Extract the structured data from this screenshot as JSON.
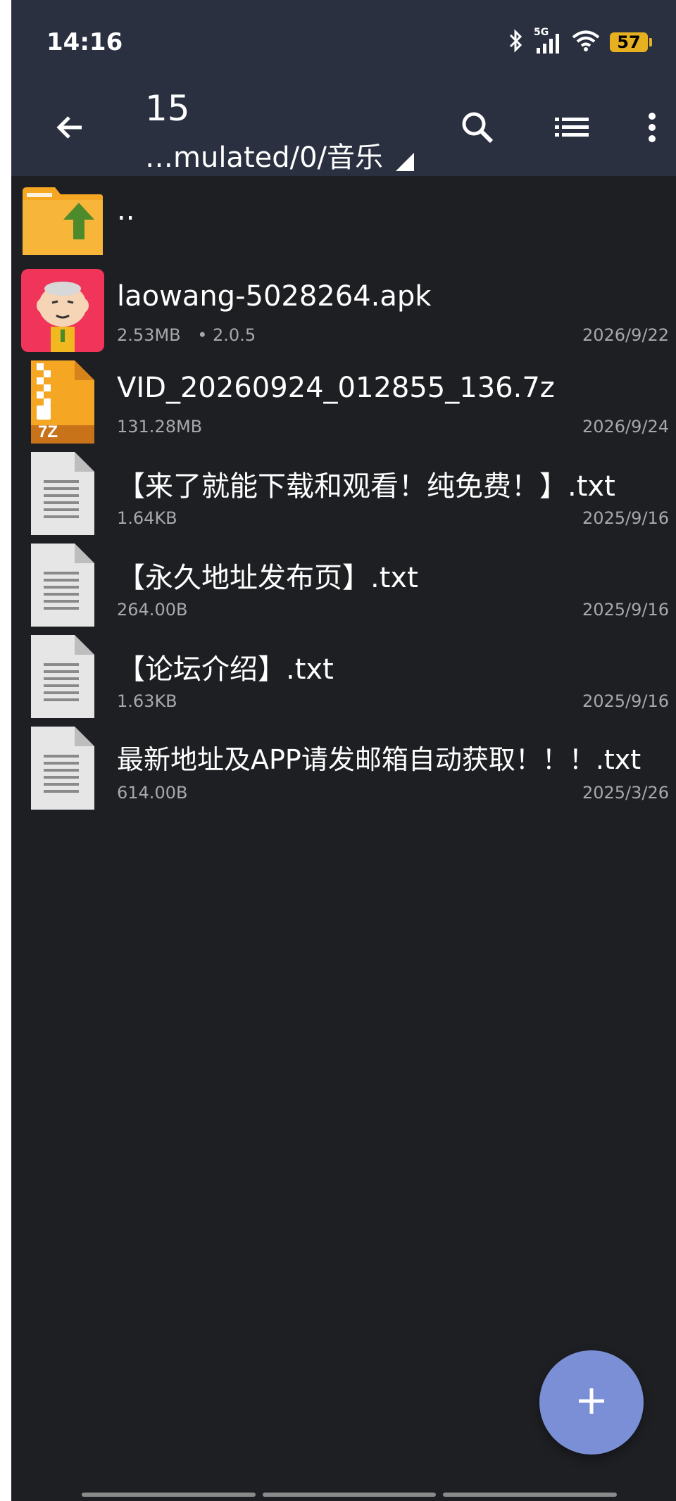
{
  "status_bar": {
    "time": "14:16",
    "network_label": "5G",
    "battery": "57",
    "icons": [
      "bluetooth-icon",
      "signal-icon",
      "wifi-icon",
      "battery-icon"
    ]
  },
  "toolbar": {
    "title": "15",
    "path": "…mulated/0/音乐",
    "icons": [
      "back-arrow-icon",
      "search-icon",
      "list-view-icon",
      "more-vert-icon"
    ]
  },
  "files": [
    {
      "name": "..",
      "size": "",
      "extra": "",
      "date": "",
      "icon": "folder-up-icon"
    },
    {
      "name": "laowang-5028264.apk",
      "size": "2.53MB",
      "extra": "• 2.0.5",
      "date": "2026/9/22",
      "icon": "apk-app-icon"
    },
    {
      "name": "VID_20260924_012855_136.7z",
      "size": "131.28MB",
      "extra": "",
      "date": "2026/9/24",
      "icon": "7z-archive-icon",
      "icon_label": "7Z"
    },
    {
      "name": "【来了就能下载和观看！纯免费！】.txt",
      "size": "1.64KB",
      "extra": "",
      "date": "2025/9/16",
      "icon": "text-file-icon"
    },
    {
      "name": "【永久地址发布页】.txt",
      "size": "264.00B",
      "extra": "",
      "date": "2025/9/16",
      "icon": "text-file-icon"
    },
    {
      "name": "【论坛介绍】.txt",
      "size": "1.63KB",
      "extra": "",
      "date": "2025/9/16",
      "icon": "text-file-icon"
    },
    {
      "name": "最新地址及APP请发邮箱自动获取！！！.txt",
      "size": "614.00B",
      "extra": "",
      "date": "2025/3/26",
      "icon": "text-file-icon"
    }
  ],
  "fab": {
    "icon": "plus-icon"
  },
  "colors": {
    "toolbar_bg": "#2a3040",
    "list_bg": "#1e1f23",
    "fab": "#7a8fd6",
    "folder": "#f5a623",
    "battery": "#e6b020"
  }
}
